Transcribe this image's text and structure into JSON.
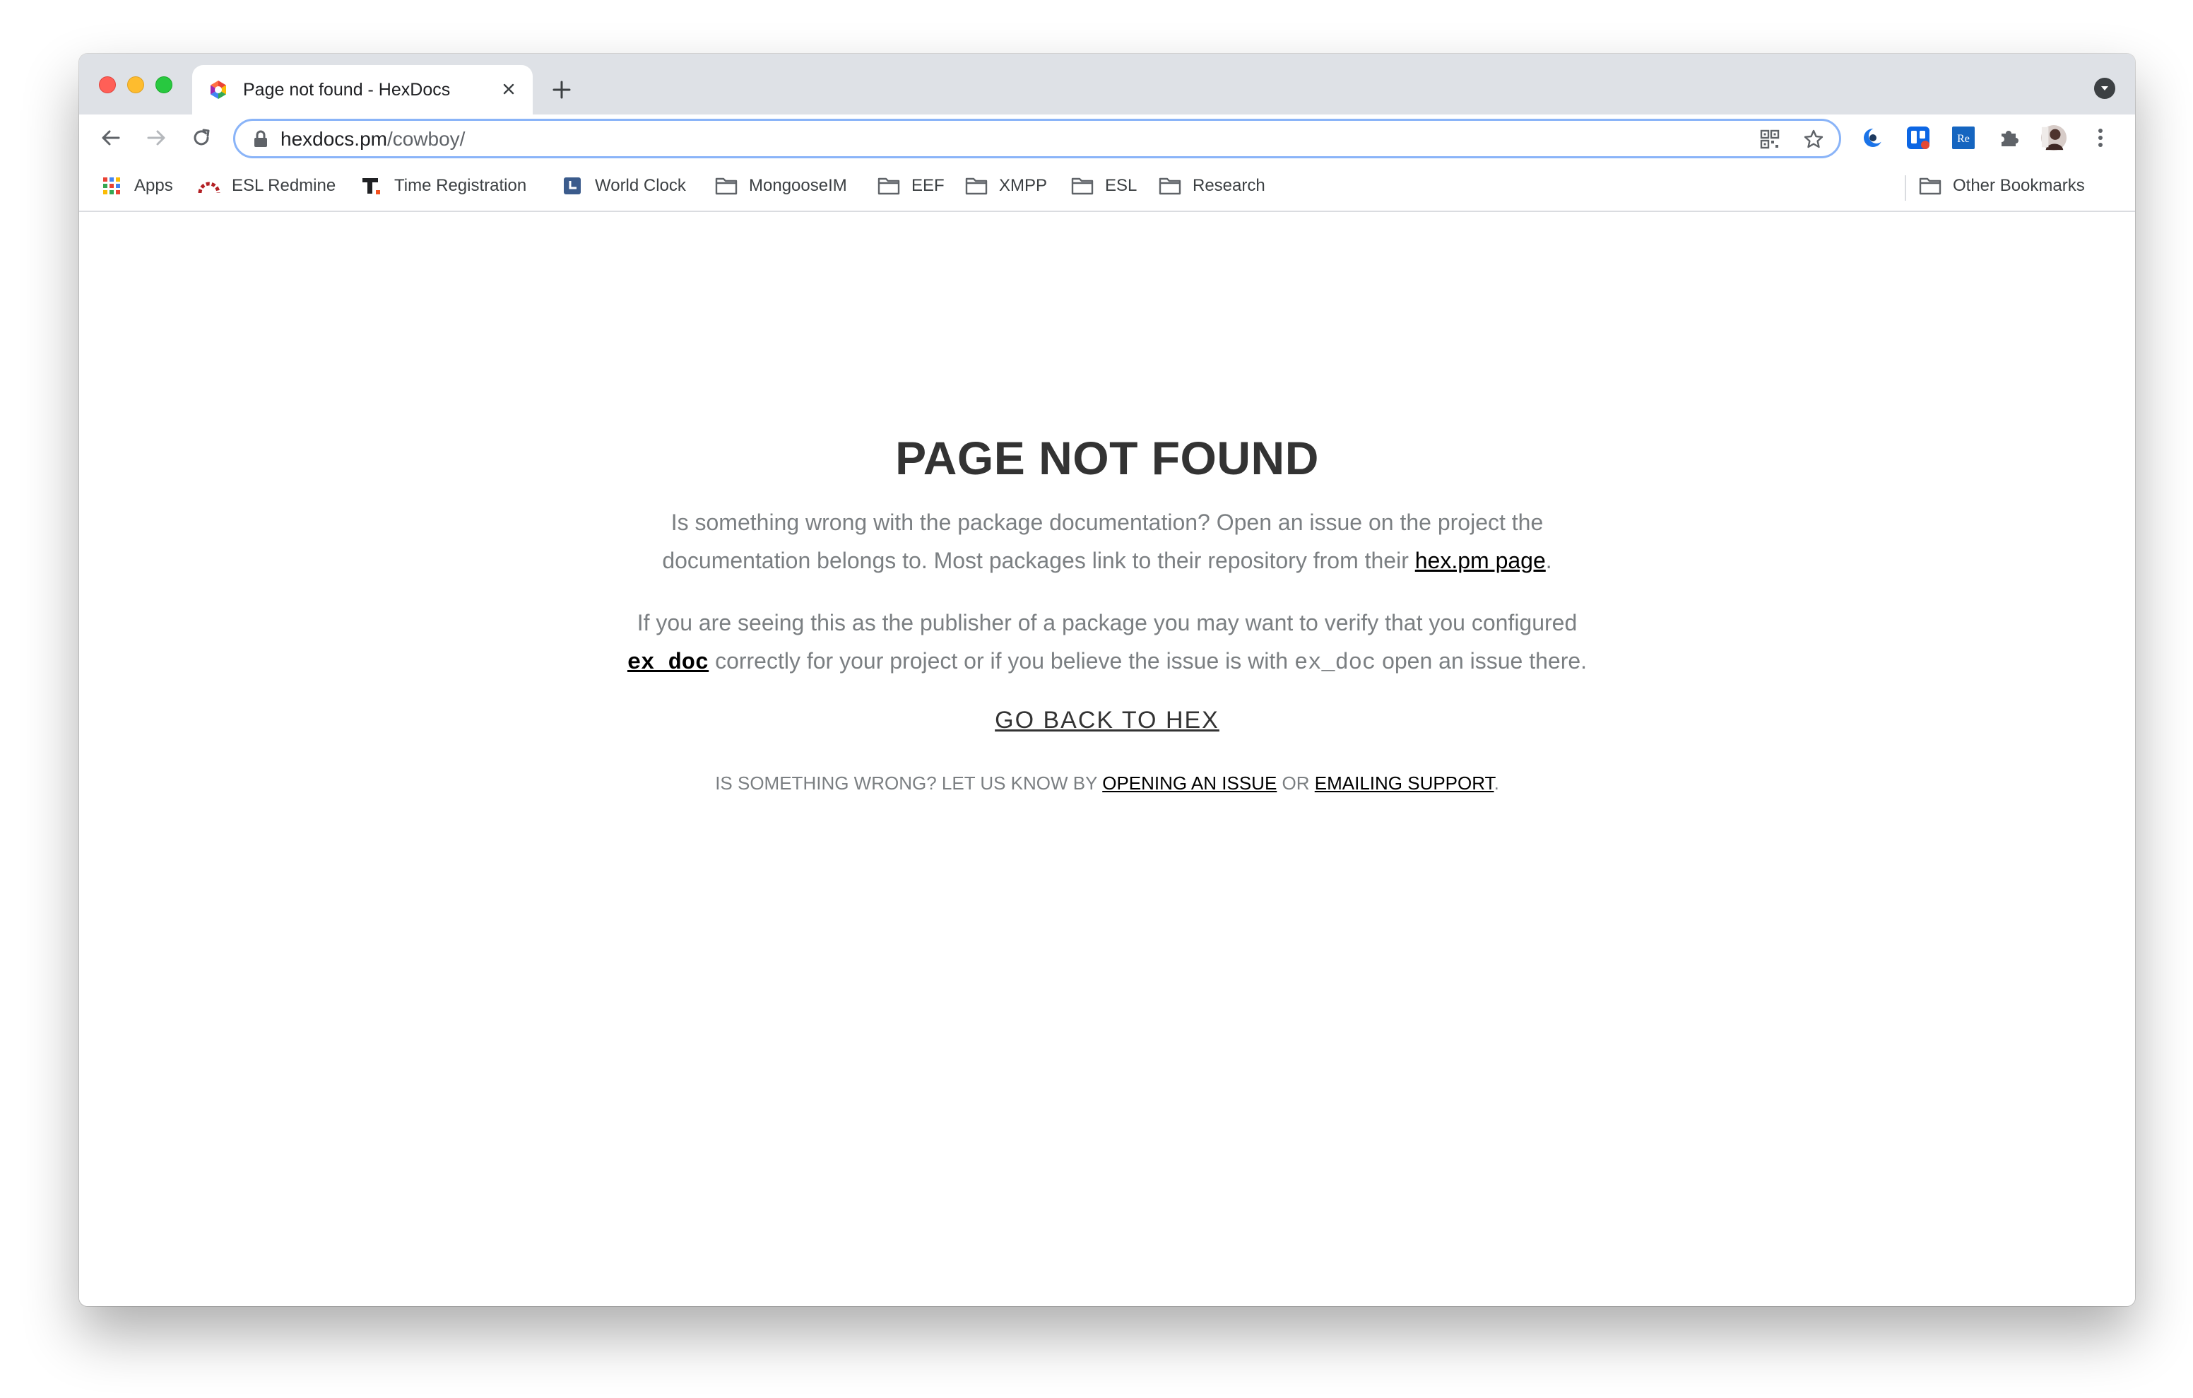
{
  "browser": {
    "tab": {
      "title": "Page not found - HexDocs"
    },
    "address_bar": {
      "host": "hexdocs.pm",
      "path": "/cowboy/"
    },
    "accent_color": "#8ab4f8"
  },
  "bookmarks": {
    "apps": "Apps",
    "esl_redmine": "ESL Redmine",
    "time_registration": "Time Registration",
    "world_clock": "World Clock",
    "mongooseim": "MongooseIM",
    "eef": "EEF",
    "xmpp": "XMPP",
    "esl": "ESL",
    "research": "Research",
    "other": "Other Bookmarks"
  },
  "page": {
    "title": "PAGE NOT FOUND",
    "para1_text": "Is something wrong with the package documentation? Open an issue on the project the documentation belongs to. Most packages link to their repository from their ",
    "para1_link": "hex.pm page",
    "para1_end": ".",
    "para2_text": "If you are seeing this as the publisher of a package you may want to verify that you configured ",
    "para2_link": "ex_doc",
    "para2_mid": " correctly for your project or if you believe the issue is with ",
    "para2_code": "ex_doc",
    "para2_end": " open an issue there.",
    "go_back": "GO BACK TO HEX",
    "footer_prefix": "IS SOMETHING WRONG? LET US KNOW BY ",
    "footer_link1": "OPENING AN ISSUE",
    "footer_or": " OR ",
    "footer_link2": "EMAILING SUPPORT",
    "footer_end": "."
  }
}
